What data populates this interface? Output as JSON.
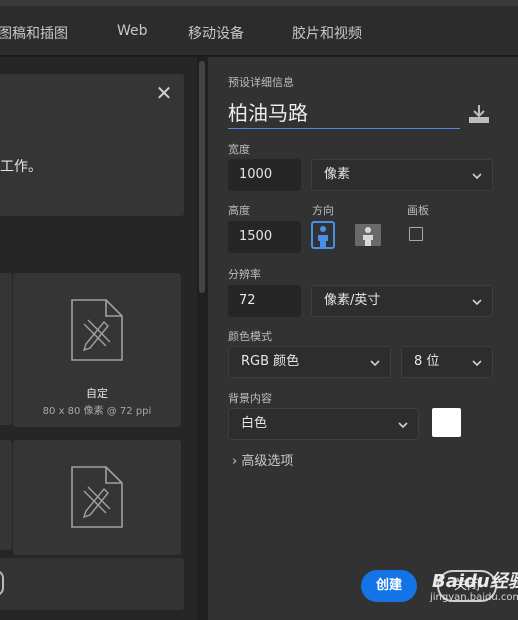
{
  "tabs": [
    "图稿和插图",
    "Web",
    "移动设备",
    "胶片和视频"
  ],
  "left_panel": {
    "message_text": "工作。",
    "preset": {
      "name": "自定",
      "details": "80 x 80 像素 @ 72 ppi"
    }
  },
  "right_panel": {
    "section_label": "预设详细信息",
    "doc_name": "柏油马路",
    "width": {
      "label": "宽度",
      "value": "1000",
      "unit": "像素"
    },
    "height": {
      "label": "高度",
      "value": "1500"
    },
    "orientation": {
      "label": "方向",
      "selected": "portrait"
    },
    "artboard": {
      "label": "画板",
      "checked": false
    },
    "resolution": {
      "label": "分辨率",
      "value": "72",
      "unit": "像素/英寸"
    },
    "color_mode": {
      "label": "颜色模式",
      "mode": "RGB 颜色",
      "bits": "8 位"
    },
    "background": {
      "label": "背景内容",
      "value": "白色",
      "swatch": "#ffffff"
    },
    "advanced_label": "高级选项",
    "create_label": "创建",
    "close_label": "关闭"
  },
  "watermark": {
    "brand": "Baidu经验",
    "url": "jingyan.baidu.com"
  },
  "colors": {
    "accent": "#1473e6",
    "panel": "#323232",
    "field": "#262626"
  }
}
